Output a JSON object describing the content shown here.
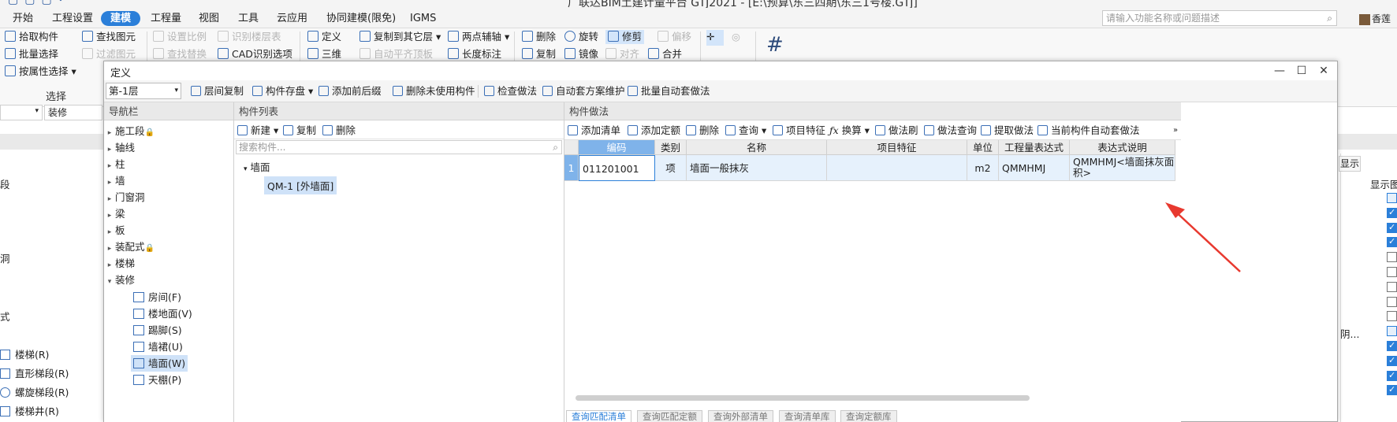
{
  "app": {
    "title_fragment": "广联达BIM土建计量平台 GTJ2021 - [E:\\预算\\东三四期\\东三1号楼.GTJ]",
    "menu": [
      "开始",
      "工程设置",
      "建模",
      "工程量",
      "视图",
      "工具",
      "云应用",
      "协同建模(限免)",
      "IGMS"
    ],
    "active_menu": "建模",
    "search_placeholder": "请输入功能名称或问题描述",
    "user_name": "香莲"
  },
  "ribbon": {
    "group1": [
      "拾取构件",
      "批量选择",
      "按属性选择"
    ],
    "group1_label": "选择",
    "group2": [
      "查找图元",
      "过滤图元"
    ],
    "group3": [
      "设置比例",
      "识别楼层表",
      "查找替换",
      "CAD识别选项"
    ],
    "group4": [
      "定义",
      "三维"
    ],
    "group5": [
      "复制到其它层",
      "自动平齐顶板"
    ],
    "group6": [
      "两点辅轴",
      "长度标注"
    ],
    "group7": [
      "删除",
      "旋转",
      "修剪",
      "偏移",
      "复制",
      "镜像",
      "对齐",
      "合并"
    ]
  },
  "background": {
    "combo_value": "",
    "combo2_value": "装修",
    "left_items": [
      "段",
      "洞",
      "式"
    ],
    "left_sub": [
      "楼梯(R)",
      "直形梯段(R)",
      "螺旋梯段(R)",
      "楼梯井(R)"
    ],
    "right_header": "显示图",
    "right_tab": "显示",
    "right_ellipsis": "阴...",
    "checkboxes": [
      "sq",
      "on",
      "on",
      "on",
      "off",
      "off",
      "off",
      "off",
      "off",
      "sq",
      "on",
      "on",
      "on",
      "on"
    ]
  },
  "dialog": {
    "title": "定义",
    "floor": "第-1层",
    "toolbar": [
      "层间复制",
      "构件存盘",
      "添加前后缀",
      "删除未使用构件",
      "检查做法",
      "自动套方案维护",
      "批量自动套做法"
    ],
    "nav": {
      "header": "导航栏",
      "items": [
        "施工段",
        "轴线",
        "柱",
        "墙",
        "门窗洞",
        "梁",
        "板",
        "装配式",
        "楼梯",
        "装修"
      ],
      "sub_items": [
        "房间(F)",
        "楼地面(V)",
        "踢脚(S)",
        "墙裙(U)",
        "墙面(W)",
        "天棚(P)"
      ],
      "selected_sub": "墙面(W)"
    },
    "component_list": {
      "header": "构件列表",
      "toolbar": [
        "新建",
        "复制",
        "删除"
      ],
      "search_placeholder": "搜索构件...",
      "tree_root": "墙面",
      "tree_child": "QM-1 [外墙面]"
    },
    "method": {
      "header": "构件做法",
      "toolbar": [
        "添加清单",
        "添加定额",
        "删除",
        "查询",
        "项目特征",
        "换算",
        "做法刷",
        "做法查询",
        "提取做法",
        "当前构件自动套做法"
      ],
      "columns": [
        "编码",
        "类别",
        "名称",
        "项目特征",
        "单位",
        "工程量表达式",
        "表达式说明"
      ],
      "rows": [
        {
          "no": "1",
          "code": "011201001",
          "type": "项",
          "name": "墙面一般抹灰",
          "feature": "",
          "unit": "m2",
          "expr": "QMMHMJ",
          "desc": "QMMHMJ<墙面抹灰面积>"
        }
      ],
      "bottom_tabs": [
        "查询匹配清单",
        "查询匹配定额",
        "查询外部清单",
        "查询清单库",
        "查询定额库"
      ]
    }
  },
  "colors": {
    "accent": "#2b7fd9",
    "arrow": "#e8392f",
    "header_blue": "#7fb3ea"
  }
}
